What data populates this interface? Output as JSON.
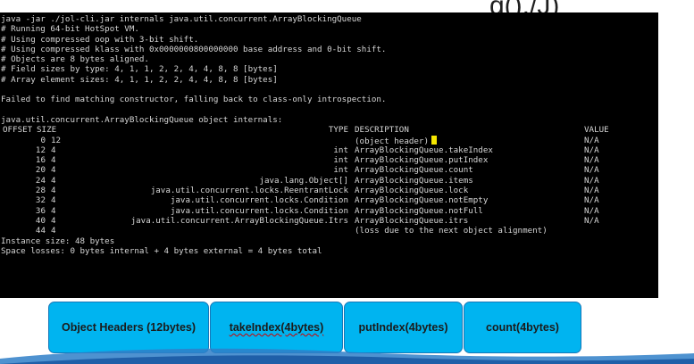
{
  "title_fragment": "g(),/J)",
  "terminal": {
    "header_lines": [
      "java -jar ./jol-cli.jar internals java.util.concurrent.ArrayBlockingQueue",
      "# Running 64-bit HotSpot VM.",
      "# Using compressed oop with 3-bit shift.",
      "# Using compressed klass with 0x0000000800000000 base address and 0-bit shift.",
      "# Objects are 8 bytes aligned.",
      "# Field sizes by type: 4, 1, 1, 2, 2, 4, 4, 8, 8 [bytes]",
      "# Array element sizes: 4, 1, 1, 2, 2, 4, 4, 8, 8 [bytes]"
    ],
    "warning": "Failed to find matching constructor, falling back to class-only introspection.",
    "internals_title": "java.util.concurrent.ArrayBlockingQueue object internals:",
    "columns": {
      "offset": "OFFSET",
      "size": "SIZE",
      "type": "TYPE",
      "description": "DESCRIPTION",
      "value": "VALUE"
    },
    "rows": [
      {
        "offset": "0",
        "size": "12",
        "type": "",
        "description": "(object header)",
        "value": "N/A"
      },
      {
        "offset": "12",
        "size": "4",
        "type": "int",
        "description": "ArrayBlockingQueue.takeIndex",
        "value": "N/A"
      },
      {
        "offset": "16",
        "size": "4",
        "type": "int",
        "description": "ArrayBlockingQueue.putIndex",
        "value": "N/A"
      },
      {
        "offset": "20",
        "size": "4",
        "type": "int",
        "description": "ArrayBlockingQueue.count",
        "value": "N/A"
      },
      {
        "offset": "24",
        "size": "4",
        "type": "java.lang.Object[]",
        "description": "ArrayBlockingQueue.items",
        "value": "N/A"
      },
      {
        "offset": "28",
        "size": "4",
        "type": "java.util.concurrent.locks.ReentrantLock",
        "description": "ArrayBlockingQueue.lock",
        "value": "N/A"
      },
      {
        "offset": "32",
        "size": "4",
        "type": "java.util.concurrent.locks.Condition",
        "description": "ArrayBlockingQueue.notEmpty",
        "value": "N/A"
      },
      {
        "offset": "36",
        "size": "4",
        "type": "java.util.concurrent.locks.Condition",
        "description": "ArrayBlockingQueue.notFull",
        "value": "N/A"
      },
      {
        "offset": "40",
        "size": "4",
        "type": "java.util.concurrent.ArrayBlockingQueue.Itrs",
        "description": "ArrayBlockingQueue.itrs",
        "value": "N/A"
      },
      {
        "offset": "44",
        "size": "4",
        "type": "",
        "description": "(loss due to the next object alignment)",
        "value": ""
      }
    ],
    "instance_size": "Instance size: 48 bytes",
    "space_losses": "Space losses: 0 bytes internal + 4 bytes external = 4 bytes total"
  },
  "boxes": [
    {
      "label": "Object Headers (12bytes)"
    },
    {
      "label": "takeIndex(4bytes)"
    },
    {
      "label": "putIndex(4bytes)"
    },
    {
      "label": "count(4bytes)"
    }
  ],
  "colors": {
    "terminal_bg": "#000000",
    "terminal_text": "#d6d6d6",
    "cursor": "#f5e600",
    "box_fill": "#00b4f0",
    "box_border": "#1677b8",
    "wave": "#2f7fc8"
  }
}
